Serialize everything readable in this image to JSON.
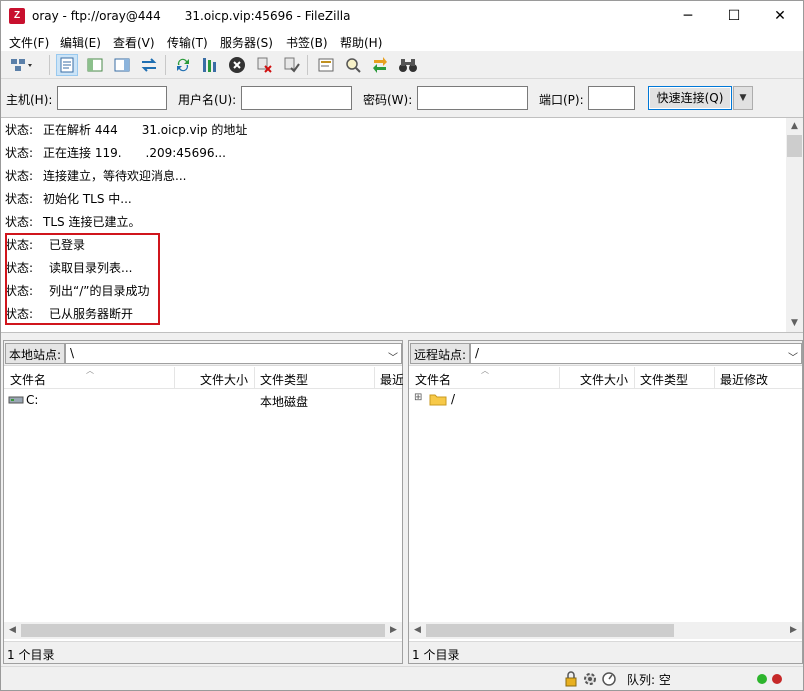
{
  "window": {
    "title": "oray - ftp://oray@444    31.oicp.vip:45696 - FileZilla",
    "app_icon_text": "Z"
  },
  "menu": [
    "文件(F)",
    "编辑(E)",
    "查看(V)",
    "传输(T)",
    "服务器(S)",
    "书签(B)",
    "帮助(H)"
  ],
  "quickconnect": {
    "host_label": "主机(H):",
    "user_label": "用户名(U):",
    "password_label": "密码(W):",
    "port_label": "端口(P):",
    "host_value": "",
    "user_value": "",
    "password_value": "",
    "port_value": "",
    "connect_button": "快速连接(Q)"
  },
  "log": [
    {
      "status": "状态:",
      "message": "正在解析 444    31.oicp.vip 的地址"
    },
    {
      "status": "状态:",
      "message": "正在连接 119.    .209:45696..."
    },
    {
      "status": "状态:",
      "message": "连接建立，等待欢迎消息..."
    },
    {
      "status": "状态:",
      "message": "初始化 TLS 中..."
    },
    {
      "status": "状态:",
      "message": "TLS 连接已建立。"
    },
    {
      "status": "状态:",
      "message": "已登录"
    },
    {
      "status": "状态:",
      "message": "读取目录列表..."
    },
    {
      "status": "状态:",
      "message": "列出“/”的目录成功"
    },
    {
      "status": "状态:",
      "message": "已从服务器断开"
    }
  ],
  "local": {
    "site_label": "本地站点:",
    "path": "\\",
    "columns": [
      "文件名",
      "文件大小",
      "文件类型",
      "最近"
    ],
    "rows": [
      {
        "name": "C:",
        "size": "",
        "type": "本地磁盘"
      }
    ],
    "footer": "1 个目录"
  },
  "remote": {
    "site_label": "远程站点:",
    "path": "/",
    "columns": [
      "文件名",
      "文件大小",
      "文件类型",
      "最近修改"
    ],
    "rows": [
      {
        "name": "/",
        "expander": "⊞"
      }
    ],
    "footer": "1 个目录"
  },
  "statusbar": {
    "queue_label": "队列: 空"
  },
  "colors": {
    "highlight": "#d0151c",
    "accent": "#0078d7",
    "led_green": "#2db52d",
    "led_red": "#c62828"
  }
}
